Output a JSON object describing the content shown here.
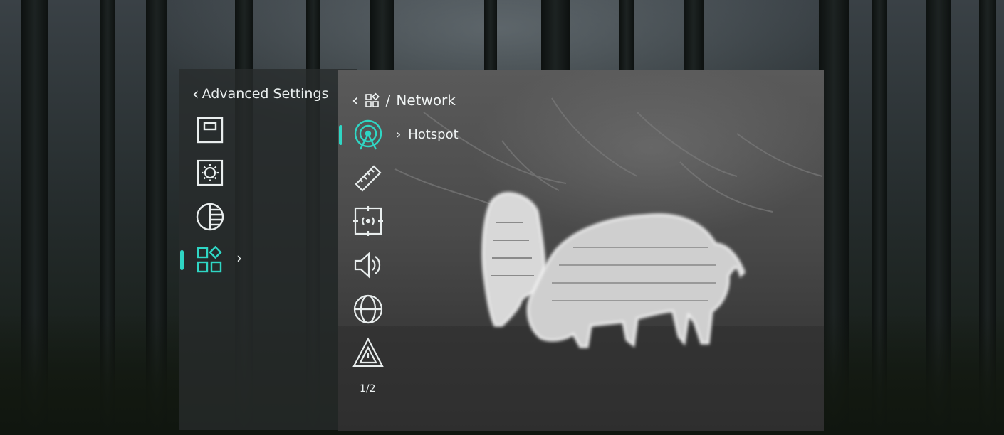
{
  "advanced_settings": {
    "title": "Advanced Settings",
    "items": [
      {
        "icon": "display-frame-icon",
        "selected": false
      },
      {
        "icon": "brightness-icon",
        "selected": false
      },
      {
        "icon": "contrast-icon",
        "selected": false
      },
      {
        "icon": "function-grid-icon",
        "selected": true
      }
    ]
  },
  "network_panel": {
    "breadcrumb_separator": "/",
    "breadcrumb_title": "Network",
    "items": [
      {
        "icon": "hotspot-icon",
        "selected": true,
        "label": "Hotspot"
      },
      {
        "icon": "ruler-icon",
        "selected": false
      },
      {
        "icon": "target-focus-icon",
        "selected": false
      },
      {
        "icon": "speaker-icon",
        "selected": false
      },
      {
        "icon": "globe-icon",
        "selected": false
      },
      {
        "icon": "warning-triangle-icon",
        "selected": false
      }
    ],
    "page_indicator": "1/2"
  },
  "colors": {
    "accent": "#2fd6c4",
    "text": "#f0f4f4"
  }
}
